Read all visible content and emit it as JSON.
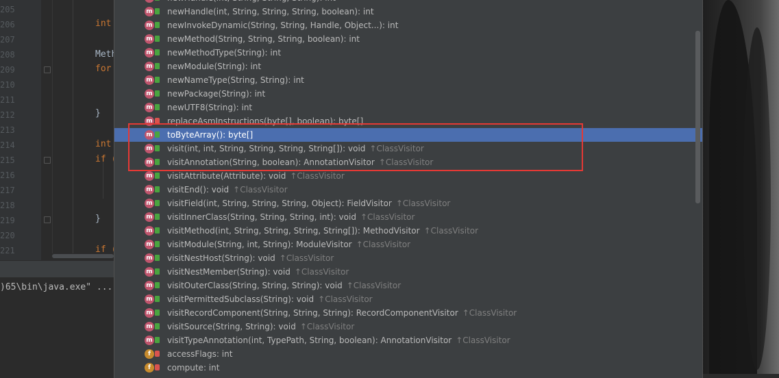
{
  "editor": {
    "line_numbers": [
      "205",
      "206",
      "207",
      "208",
      "209",
      "210",
      "211",
      "212",
      "213",
      "214",
      "215",
      "216",
      "217",
      "218",
      "219",
      "220",
      "221"
    ],
    "code_fragments": {
      "l206": "int",
      "l208": "Meth",
      "l209": "for",
      "l212": "}",
      "l214": "int",
      "l215": "if (",
      "l219": "}",
      "l221": "if ("
    }
  },
  "console": {
    "command_fragment": ")65\\bin\\java.exe\" ..."
  },
  "completion": {
    "items": [
      {
        "kind": "m",
        "access": "pub",
        "signature": "newHandle(int, String, String, String): int",
        "owner": ""
      },
      {
        "kind": "m",
        "access": "pub",
        "signature": "newHandle(int, String, String, String, boolean): int",
        "owner": ""
      },
      {
        "kind": "m",
        "access": "pub",
        "signature": "newInvokeDynamic(String, String, Handle, Object...): int",
        "owner": ""
      },
      {
        "kind": "m",
        "access": "pub",
        "signature": "newMethod(String, String, String, boolean): int",
        "owner": ""
      },
      {
        "kind": "m",
        "access": "pub",
        "signature": "newMethodType(String): int",
        "owner": ""
      },
      {
        "kind": "m",
        "access": "pub",
        "signature": "newModule(String): int",
        "owner": ""
      },
      {
        "kind": "m",
        "access": "pub",
        "signature": "newNameType(String, String): int",
        "owner": ""
      },
      {
        "kind": "m",
        "access": "pub",
        "signature": "newPackage(String): int",
        "owner": ""
      },
      {
        "kind": "m",
        "access": "pub",
        "signature": "newUTF8(String): int",
        "owner": ""
      },
      {
        "kind": "m",
        "access": "priv",
        "signature": "replaceAsmInstructions(byte[], boolean): byte[]",
        "owner": ""
      },
      {
        "kind": "m",
        "access": "pub",
        "signature": "toByteArray(): byte[]",
        "owner": "",
        "selected": true
      },
      {
        "kind": "m",
        "access": "pub",
        "signature": "visit(int, int, String, String, String, String[]): void",
        "owner": "↑ClassVisitor"
      },
      {
        "kind": "m",
        "access": "pub",
        "signature": "visitAnnotation(String, boolean): AnnotationVisitor",
        "owner": "↑ClassVisitor"
      },
      {
        "kind": "m",
        "access": "pub",
        "signature": "visitAttribute(Attribute): void",
        "owner": "↑ClassVisitor"
      },
      {
        "kind": "m",
        "access": "pub",
        "signature": "visitEnd(): void",
        "owner": "↑ClassVisitor"
      },
      {
        "kind": "m",
        "access": "pub",
        "signature": "visitField(int, String, String, String, Object): FieldVisitor",
        "owner": "↑ClassVisitor"
      },
      {
        "kind": "m",
        "access": "pub",
        "signature": "visitInnerClass(String, String, String, int): void",
        "owner": "↑ClassVisitor"
      },
      {
        "kind": "m",
        "access": "pub",
        "signature": "visitMethod(int, String, String, String, String[]): MethodVisitor",
        "owner": "↑ClassVisitor"
      },
      {
        "kind": "m",
        "access": "pub",
        "signature": "visitModule(String, int, String): ModuleVisitor",
        "owner": "↑ClassVisitor"
      },
      {
        "kind": "m",
        "access": "pub",
        "signature": "visitNestHost(String): void",
        "owner": "↑ClassVisitor"
      },
      {
        "kind": "m",
        "access": "pub",
        "signature": "visitNestMember(String): void",
        "owner": "↑ClassVisitor"
      },
      {
        "kind": "m",
        "access": "pub",
        "signature": "visitOuterClass(String, String, String): void",
        "owner": "↑ClassVisitor"
      },
      {
        "kind": "m",
        "access": "pub",
        "signature": "visitPermittedSubclass(String): void",
        "owner": "↑ClassVisitor"
      },
      {
        "kind": "m",
        "access": "pub",
        "signature": "visitRecordComponent(String, String, String): RecordComponentVisitor",
        "owner": "↑ClassVisitor"
      },
      {
        "kind": "m",
        "access": "pub",
        "signature": "visitSource(String, String): void",
        "owner": "↑ClassVisitor"
      },
      {
        "kind": "m",
        "access": "pub",
        "signature": "visitTypeAnnotation(int, TypePath, String, boolean): AnnotationVisitor",
        "owner": "↑ClassVisitor"
      },
      {
        "kind": "f",
        "access": "priv",
        "signature": "accessFlags: int",
        "owner": ""
      },
      {
        "kind": "f",
        "access": "priv",
        "signature": "compute: int",
        "owner": ""
      }
    ]
  },
  "colors": {
    "selection": "#4b6eaf",
    "method_icon": "#c0556d",
    "field_icon": "#c78b2d",
    "annotation_box": "#e53935"
  }
}
